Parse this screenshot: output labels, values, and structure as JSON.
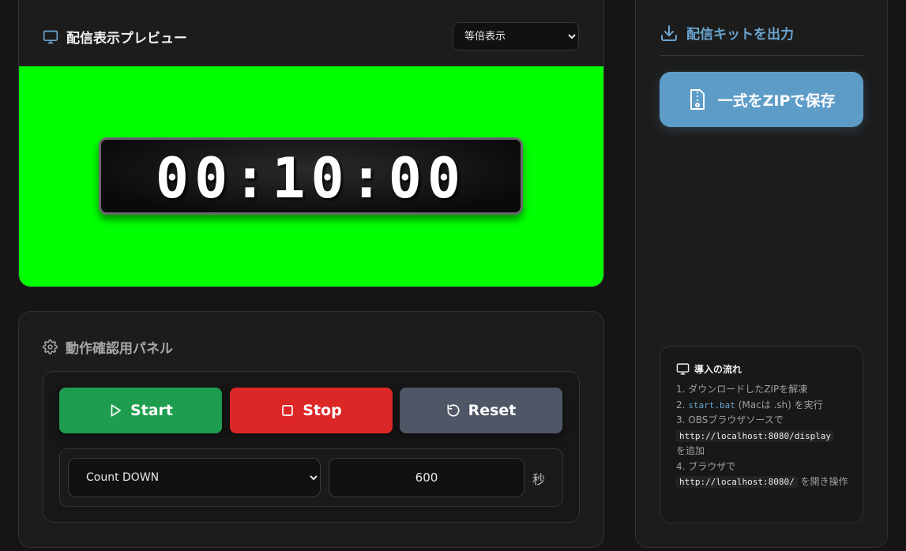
{
  "preview": {
    "title": "配信表示プレビュー",
    "zoom_options": [
      "等倍表示"
    ],
    "zoom_selected": "等倍表示",
    "timer_display": "00:10:00",
    "screen_color": "#00ff00"
  },
  "panel": {
    "title": "動作確認用パネル",
    "start_label": "Start",
    "stop_label": "Stop",
    "reset_label": "Reset",
    "mode_options": [
      "Count DOWN"
    ],
    "mode_selected": "Count DOWN",
    "seconds_value": "600",
    "seconds_unit": "秒"
  },
  "export": {
    "title": "配信キットを出力",
    "zip_label": "一式をZIPで保存",
    "flow_title": "導入の流れ",
    "step1": "1. ダウンロードしたZIPを解凍",
    "step2_prefix": "2. ",
    "step2_code": "start.bat",
    "step2_suffix": " (Macは .sh) を実行",
    "step3_prefix": "3. OBSブラウザソースで",
    "step3_code": "http://localhost:8080/display",
    "step3_suffix": "を追加",
    "step4_prefix": "4. ブラウザで",
    "step4_code": "http://localhost:8080/",
    "step4_suffix": " を開き操作"
  },
  "colors": {
    "start": "#1f9d4f",
    "stop": "#dd2626",
    "reset": "#4f5665",
    "accent": "#6aa4cf",
    "zip_button": "#5e9cc8"
  }
}
